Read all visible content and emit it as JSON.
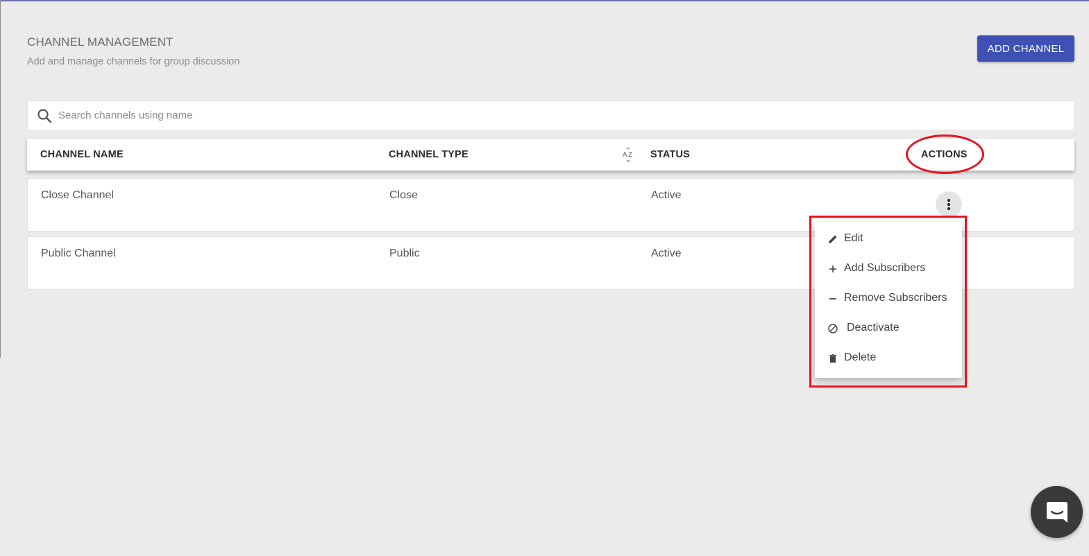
{
  "header": {
    "title": "CHANNEL MANAGEMENT",
    "subtitle": "Add and manage channels for group discussion",
    "add_button_label": "ADD CHANNEL"
  },
  "search": {
    "placeholder": "Search channels using name",
    "value": ""
  },
  "table": {
    "columns": [
      "CHANNEL NAME",
      "CHANNEL TYPE",
      "STATUS",
      "ACTIONS"
    ],
    "rows": [
      {
        "name": "Close Channel",
        "type": "Close",
        "status": "Active"
      },
      {
        "name": "Public Channel",
        "type": "Public",
        "status": "Active"
      }
    ]
  },
  "actions_menu": {
    "items": [
      {
        "label": "Edit",
        "icon": "pencil-icon"
      },
      {
        "label": "Add Subscribers",
        "icon": "plus-icon"
      },
      {
        "label": "Remove Subscribers",
        "icon": "minus-icon"
      },
      {
        "label": "Deactivate",
        "icon": "block-icon"
      },
      {
        "label": "Delete",
        "icon": "trash-icon"
      }
    ]
  },
  "icons": {
    "search": "search-icon",
    "sort": "sort-az-icon",
    "row_actions": "more-vert-icon",
    "chat": "chat-icon"
  },
  "colors": {
    "accent": "#3f51b5",
    "highlight": "#e8131b",
    "background": "#ebebeb"
  }
}
